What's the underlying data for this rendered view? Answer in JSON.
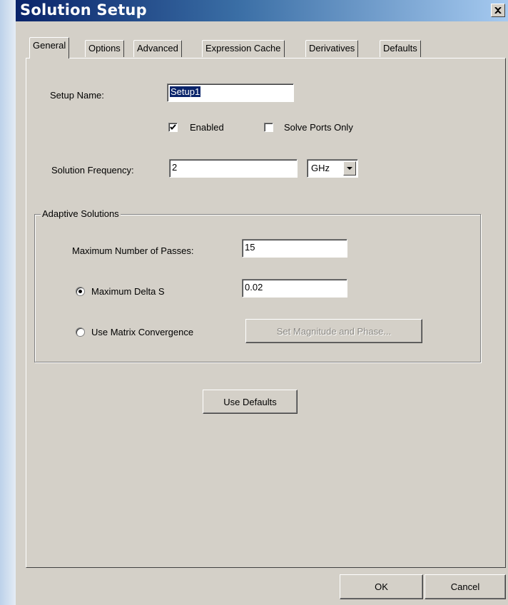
{
  "window": {
    "title": "Solution Setup"
  },
  "tabs": [
    "General",
    "Options",
    "Advanced",
    "Expression Cache",
    "Derivatives",
    "Defaults"
  ],
  "general": {
    "setup_name_label": "Setup Name:",
    "setup_name_value": "Setup1",
    "enabled_label": "Enabled",
    "enabled_checked": true,
    "solve_ports_label": "Solve Ports Only",
    "solve_ports_checked": false,
    "frequency_label": "Solution Frequency:",
    "frequency_value": "2",
    "frequency_unit": "GHz"
  },
  "adaptive": {
    "group_label": "Adaptive Solutions",
    "max_passes_label": "Maximum Number of Passes:",
    "max_passes_value": "15",
    "delta_s_label": "Maximum Delta S",
    "delta_s_value": "0.02",
    "delta_s_selected": true,
    "matrix_label": "Use Matrix Convergence",
    "matrix_selected": false,
    "set_mag_phase_label": "Set Magnitude and Phase..."
  },
  "buttons": {
    "use_defaults": "Use Defaults",
    "ok": "OK",
    "cancel": "Cancel"
  }
}
